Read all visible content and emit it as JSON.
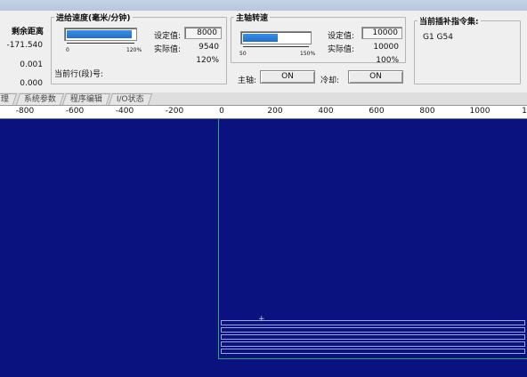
{
  "remaining": {
    "title": "剩余距离",
    "values": [
      "-171.540",
      "0.001",
      "0.000"
    ]
  },
  "feed": {
    "title": "进给速度(毫米/分钟)",
    "bar_level": 0.95,
    "scale_min": "0",
    "scale_max": "120%",
    "set_label": "设定值:",
    "set_value": "8000",
    "actual_label": "实际值:",
    "actual_value": "9540",
    "percent": "120%"
  },
  "current_line": {
    "label": "当前行(段)号:"
  },
  "spindle": {
    "title": "主轴转速",
    "bar_level": 0.55,
    "scale_min": "50",
    "scale_max": "150%",
    "set_label": "设定值:",
    "set_value": "10000",
    "actual_label": "实际值:",
    "actual_value": "10000",
    "percent": "100%",
    "spindle_label": "主轴:",
    "spindle_state": "ON",
    "coolant_label": "冷却:",
    "coolant_state": "ON"
  },
  "interp": {
    "title": "当前插补指令集:",
    "value": "G1 G54"
  },
  "tabs": [
    "理",
    "系统参数",
    "程序编辑",
    "I/O状态"
  ],
  "ruler": {
    "labels": [
      "-800",
      "-600",
      "-400",
      "-200",
      "0",
      "200",
      "400",
      "600",
      "800",
      "1000",
      "1"
    ]
  },
  "colors": {
    "canvas_bg": "#0a1280",
    "bar_fill": "#2a7fdc",
    "axis_line": "#2fa86a"
  }
}
